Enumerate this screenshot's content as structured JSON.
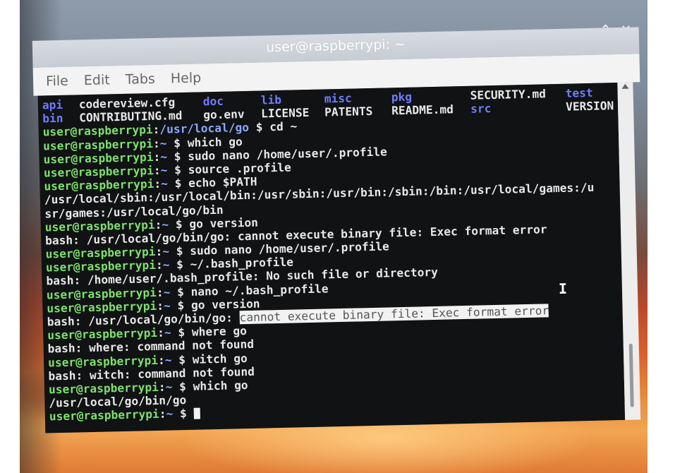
{
  "window": {
    "title": "user@raspberrypi: ~",
    "controls": [
      "⌄",
      "⌃",
      "✕"
    ]
  },
  "menu": [
    "File",
    "Edit",
    "Tabs",
    "Help"
  ],
  "listing": {
    "row1": [
      {
        "text": "api",
        "kind": "dir"
      },
      {
        "text": "codereview.cfg",
        "kind": "file"
      },
      {
        "text": "doc",
        "kind": "dir"
      },
      {
        "text": "lib",
        "kind": "dir"
      },
      {
        "text": "misc",
        "kind": "dir"
      },
      {
        "text": "pkg",
        "kind": "dir"
      },
      {
        "text": "SECURITY.md",
        "kind": "file"
      },
      {
        "text": "test",
        "kind": "dir"
      }
    ],
    "row2": [
      {
        "text": "bin",
        "kind": "dir"
      },
      {
        "text": "CONTRIBUTING.md",
        "kind": "file"
      },
      {
        "text": "go.env",
        "kind": "file"
      },
      {
        "text": "LICENSE",
        "kind": "file"
      },
      {
        "text": "PATENTS",
        "kind": "file"
      },
      {
        "text": "README.md",
        "kind": "file"
      },
      {
        "text": "src",
        "kind": "dir"
      },
      {
        "text": "VERSION",
        "kind": "file"
      }
    ]
  },
  "prompt": {
    "user": "user@raspberrypi",
    "sep": ":"
  },
  "lines": [
    {
      "type": "prompt",
      "path": "/usr/local/go",
      "cmd": "cd ~"
    },
    {
      "type": "prompt",
      "path": "~",
      "cmd": "which go"
    },
    {
      "type": "prompt",
      "path": "~",
      "cmd": "sudo nano /home/user/.profile"
    },
    {
      "type": "prompt",
      "path": "~",
      "cmd": "source .profile"
    },
    {
      "type": "prompt",
      "path": "~",
      "cmd": "echo $PATH"
    },
    {
      "type": "out",
      "text": "/usr/local/sbin:/usr/local/bin:/usr/sbin:/usr/bin:/sbin:/bin:/usr/local/games:/u"
    },
    {
      "type": "out",
      "text": "sr/games:/usr/local/go/bin"
    },
    {
      "type": "prompt",
      "path": "~",
      "cmd": "go version"
    },
    {
      "type": "out",
      "text": "bash: /usr/local/go/bin/go: cannot execute binary file: Exec format error"
    },
    {
      "type": "prompt",
      "path": "~",
      "cmd": "sudo nano /home/user/.profile"
    },
    {
      "type": "prompt",
      "path": "~",
      "cmd": "~/.bash_profile"
    },
    {
      "type": "out",
      "text": "bash: /home/user/.bash_profile: No such file or directory"
    },
    {
      "type": "prompt",
      "path": "~",
      "cmd": "nano ~/.bash_profile"
    },
    {
      "type": "prompt",
      "path": "~",
      "cmd": "go version"
    },
    {
      "type": "out_sel",
      "text": "bash: /usr/local/go/bin/go: ",
      "selected": "cannot execute binary file: Exec format error"
    },
    {
      "type": "prompt",
      "path": "~",
      "cmd": "where go"
    },
    {
      "type": "out",
      "text": "bash: where: command not found"
    },
    {
      "type": "prompt",
      "path": "~",
      "cmd": "witch go"
    },
    {
      "type": "out",
      "text": "bash: witch: command not found"
    },
    {
      "type": "prompt",
      "path": "~",
      "cmd": "which go"
    },
    {
      "type": "out",
      "text": "/usr/local/go/bin/go"
    },
    {
      "type": "prompt_cursor",
      "path": "~",
      "cmd": ""
    }
  ],
  "colors": {
    "terminal_bg": "#101213",
    "prompt_user": "#7ee16e",
    "prompt_path": "#8aa9ff",
    "dir": "#6f7dff",
    "text": "#e8e8e8"
  }
}
